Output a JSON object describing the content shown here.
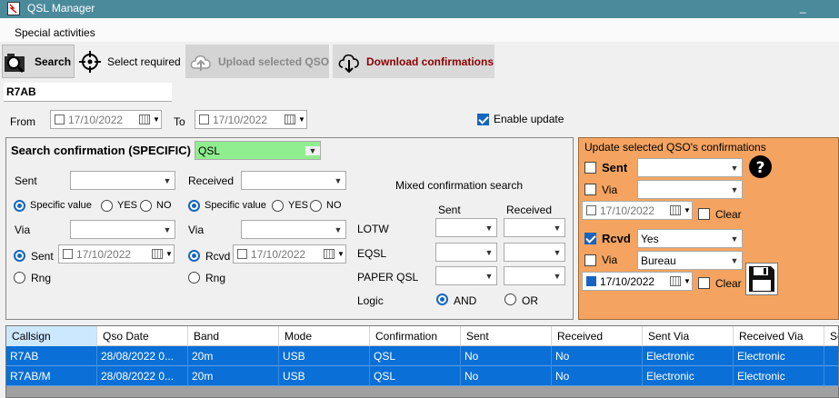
{
  "window": {
    "title": "QSL Manager",
    "minimize": "_"
  },
  "menu": {
    "items": [
      "Special activities"
    ]
  },
  "toolbar": {
    "search": "Search",
    "select_required": "Select required",
    "upload": "Upload selected QSO",
    "download": "Download confirmations"
  },
  "callsign": "R7AB",
  "range": {
    "from_label": "From",
    "from_date": "17/10/2022",
    "to_label": "To",
    "to_date": "17/10/2022",
    "enable_update_label": "Enable update",
    "enable_update_checked": true
  },
  "search": {
    "title": "Search confirmation (SPECIFIC)",
    "type_value": "QSL",
    "sent_label": "Sent",
    "received_label": "Received",
    "specific_value": "Specific value",
    "yes": "YES",
    "no": "NO",
    "via_label": "Via",
    "sent_radio": "Sent",
    "sent_date": "17/10/2022",
    "rcvd_radio": "Rcvd",
    "rcvd_date": "17/10/2022",
    "rng": "Rng"
  },
  "mixed": {
    "title": "Mixed confirmation search",
    "sent_col": "Sent",
    "received_col": "Received",
    "rows": [
      "LOTW",
      "EQSL",
      "PAPER QSL"
    ],
    "logic_label": "Logic",
    "and": "AND",
    "or": "OR"
  },
  "update": {
    "title": "Update selected QSO's confirmations",
    "sent_label": "Sent",
    "sent_checked": false,
    "via_label": "Via",
    "date1": "17/10/2022",
    "clear": "Clear",
    "rcvd_label": "Rcvd",
    "rcvd_checked": true,
    "rcvd_value": "Yes",
    "via2_value": "Bureau",
    "date2": "17/10/2022",
    "help_icon": "question-mark-icon",
    "save_icon": "floppy-disk-icon"
  },
  "grid": {
    "columns": [
      "Callsign",
      "Qso Date",
      "Band",
      "Mode",
      "Confirmation",
      "Sent",
      "Received",
      "Sent Via",
      "Received Via",
      "Se"
    ],
    "rows": [
      [
        "R7AB",
        "28/08/2022 0...",
        "20m",
        "USB",
        "QSL",
        "No",
        "No",
        "Electronic",
        "Electronic"
      ],
      [
        "R7AB/M",
        "28/08/2022 0...",
        "20m",
        "USB",
        "QSL",
        "No",
        "No",
        "Electronic",
        "Electronic"
      ]
    ]
  },
  "colors": {
    "titlebar": "#4a8a9b",
    "update_panel": "#f4a460",
    "selection": "#0a6fd6",
    "qsl_highlight": "#90ee90"
  }
}
